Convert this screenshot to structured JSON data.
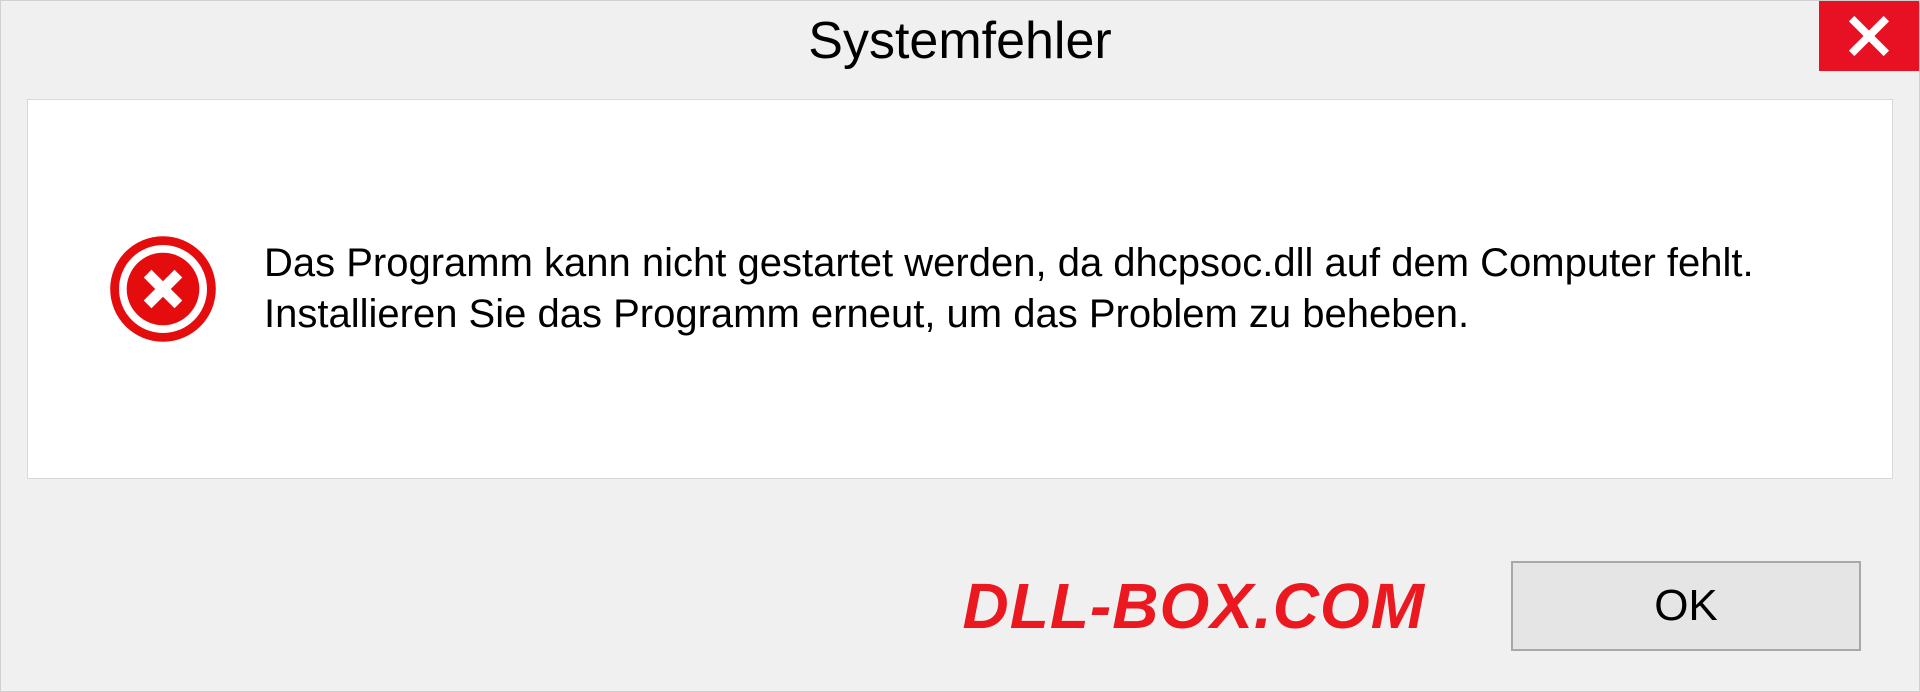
{
  "dialog": {
    "title": "Systemfehler",
    "message": "Das Programm kann nicht gestartet werden, da dhcpsoc.dll auf dem Computer fehlt. Installieren Sie das Programm erneut, um das Problem zu beheben.",
    "ok_label": "OK"
  },
  "watermark": "DLL-BOX.COM"
}
